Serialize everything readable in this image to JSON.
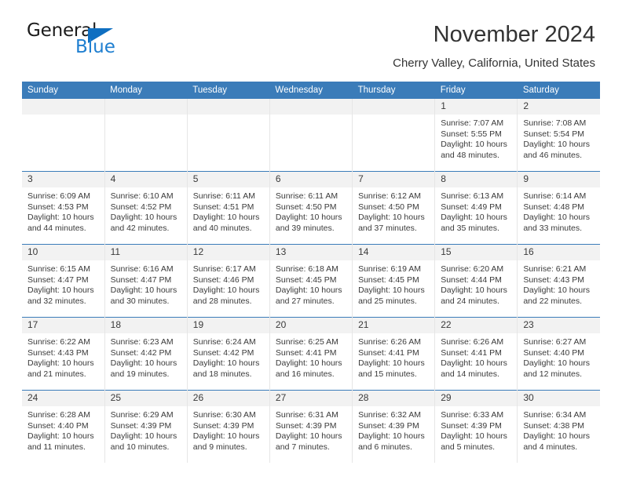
{
  "brand": {
    "name_top": "General",
    "name_bottom": "Blue",
    "accent_color": "#1f7fd0",
    "triangle_color": "#0f6fc1"
  },
  "header": {
    "title": "November 2024",
    "subtitle": "Cherry Valley, California, United States"
  },
  "theme": {
    "header_blue": "#3b7cb9",
    "date_band": "#f2f2f2",
    "text": "#3a3a3a"
  },
  "calendar": {
    "weekday_headers": [
      "Sunday",
      "Monday",
      "Tuesday",
      "Wednesday",
      "Thursday",
      "Friday",
      "Saturday"
    ],
    "labels": {
      "sunrise": "Sunrise:",
      "sunset": "Sunset:",
      "daylight": "Daylight:"
    },
    "weeks": [
      [
        {
          "day": "",
          "empty": true
        },
        {
          "day": "",
          "empty": true
        },
        {
          "day": "",
          "empty": true
        },
        {
          "day": "",
          "empty": true
        },
        {
          "day": "",
          "empty": true
        },
        {
          "day": "1",
          "sunrise": "Sunrise: 7:07 AM",
          "sunset": "Sunset: 5:55 PM",
          "daylight": "Daylight: 10 hours and 48 minutes."
        },
        {
          "day": "2",
          "sunrise": "Sunrise: 7:08 AM",
          "sunset": "Sunset: 5:54 PM",
          "daylight": "Daylight: 10 hours and 46 minutes."
        }
      ],
      [
        {
          "day": "3",
          "sunrise": "Sunrise: 6:09 AM",
          "sunset": "Sunset: 4:53 PM",
          "daylight": "Daylight: 10 hours and 44 minutes."
        },
        {
          "day": "4",
          "sunrise": "Sunrise: 6:10 AM",
          "sunset": "Sunset: 4:52 PM",
          "daylight": "Daylight: 10 hours and 42 minutes."
        },
        {
          "day": "5",
          "sunrise": "Sunrise: 6:11 AM",
          "sunset": "Sunset: 4:51 PM",
          "daylight": "Daylight: 10 hours and 40 minutes."
        },
        {
          "day": "6",
          "sunrise": "Sunrise: 6:11 AM",
          "sunset": "Sunset: 4:50 PM",
          "daylight": "Daylight: 10 hours and 39 minutes."
        },
        {
          "day": "7",
          "sunrise": "Sunrise: 6:12 AM",
          "sunset": "Sunset: 4:50 PM",
          "daylight": "Daylight: 10 hours and 37 minutes."
        },
        {
          "day": "8",
          "sunrise": "Sunrise: 6:13 AM",
          "sunset": "Sunset: 4:49 PM",
          "daylight": "Daylight: 10 hours and 35 minutes."
        },
        {
          "day": "9",
          "sunrise": "Sunrise: 6:14 AM",
          "sunset": "Sunset: 4:48 PM",
          "daylight": "Daylight: 10 hours and 33 minutes."
        }
      ],
      [
        {
          "day": "10",
          "sunrise": "Sunrise: 6:15 AM",
          "sunset": "Sunset: 4:47 PM",
          "daylight": "Daylight: 10 hours and 32 minutes."
        },
        {
          "day": "11",
          "sunrise": "Sunrise: 6:16 AM",
          "sunset": "Sunset: 4:47 PM",
          "daylight": "Daylight: 10 hours and 30 minutes."
        },
        {
          "day": "12",
          "sunrise": "Sunrise: 6:17 AM",
          "sunset": "Sunset: 4:46 PM",
          "daylight": "Daylight: 10 hours and 28 minutes."
        },
        {
          "day": "13",
          "sunrise": "Sunrise: 6:18 AM",
          "sunset": "Sunset: 4:45 PM",
          "daylight": "Daylight: 10 hours and 27 minutes."
        },
        {
          "day": "14",
          "sunrise": "Sunrise: 6:19 AM",
          "sunset": "Sunset: 4:45 PM",
          "daylight": "Daylight: 10 hours and 25 minutes."
        },
        {
          "day": "15",
          "sunrise": "Sunrise: 6:20 AM",
          "sunset": "Sunset: 4:44 PM",
          "daylight": "Daylight: 10 hours and 24 minutes."
        },
        {
          "day": "16",
          "sunrise": "Sunrise: 6:21 AM",
          "sunset": "Sunset: 4:43 PM",
          "daylight": "Daylight: 10 hours and 22 minutes."
        }
      ],
      [
        {
          "day": "17",
          "sunrise": "Sunrise: 6:22 AM",
          "sunset": "Sunset: 4:43 PM",
          "daylight": "Daylight: 10 hours and 21 minutes."
        },
        {
          "day": "18",
          "sunrise": "Sunrise: 6:23 AM",
          "sunset": "Sunset: 4:42 PM",
          "daylight": "Daylight: 10 hours and 19 minutes."
        },
        {
          "day": "19",
          "sunrise": "Sunrise: 6:24 AM",
          "sunset": "Sunset: 4:42 PM",
          "daylight": "Daylight: 10 hours and 18 minutes."
        },
        {
          "day": "20",
          "sunrise": "Sunrise: 6:25 AM",
          "sunset": "Sunset: 4:41 PM",
          "daylight": "Daylight: 10 hours and 16 minutes."
        },
        {
          "day": "21",
          "sunrise": "Sunrise: 6:26 AM",
          "sunset": "Sunset: 4:41 PM",
          "daylight": "Daylight: 10 hours and 15 minutes."
        },
        {
          "day": "22",
          "sunrise": "Sunrise: 6:26 AM",
          "sunset": "Sunset: 4:41 PM",
          "daylight": "Daylight: 10 hours and 14 minutes."
        },
        {
          "day": "23",
          "sunrise": "Sunrise: 6:27 AM",
          "sunset": "Sunset: 4:40 PM",
          "daylight": "Daylight: 10 hours and 12 minutes."
        }
      ],
      [
        {
          "day": "24",
          "sunrise": "Sunrise: 6:28 AM",
          "sunset": "Sunset: 4:40 PM",
          "daylight": "Daylight: 10 hours and 11 minutes."
        },
        {
          "day": "25",
          "sunrise": "Sunrise: 6:29 AM",
          "sunset": "Sunset: 4:39 PM",
          "daylight": "Daylight: 10 hours and 10 minutes."
        },
        {
          "day": "26",
          "sunrise": "Sunrise: 6:30 AM",
          "sunset": "Sunset: 4:39 PM",
          "daylight": "Daylight: 10 hours and 9 minutes."
        },
        {
          "day": "27",
          "sunrise": "Sunrise: 6:31 AM",
          "sunset": "Sunset: 4:39 PM",
          "daylight": "Daylight: 10 hours and 7 minutes."
        },
        {
          "day": "28",
          "sunrise": "Sunrise: 6:32 AM",
          "sunset": "Sunset: 4:39 PM",
          "daylight": "Daylight: 10 hours and 6 minutes."
        },
        {
          "day": "29",
          "sunrise": "Sunrise: 6:33 AM",
          "sunset": "Sunset: 4:39 PM",
          "daylight": "Daylight: 10 hours and 5 minutes."
        },
        {
          "day": "30",
          "sunrise": "Sunrise: 6:34 AM",
          "sunset": "Sunset: 4:38 PM",
          "daylight": "Daylight: 10 hours and 4 minutes."
        }
      ]
    ]
  }
}
